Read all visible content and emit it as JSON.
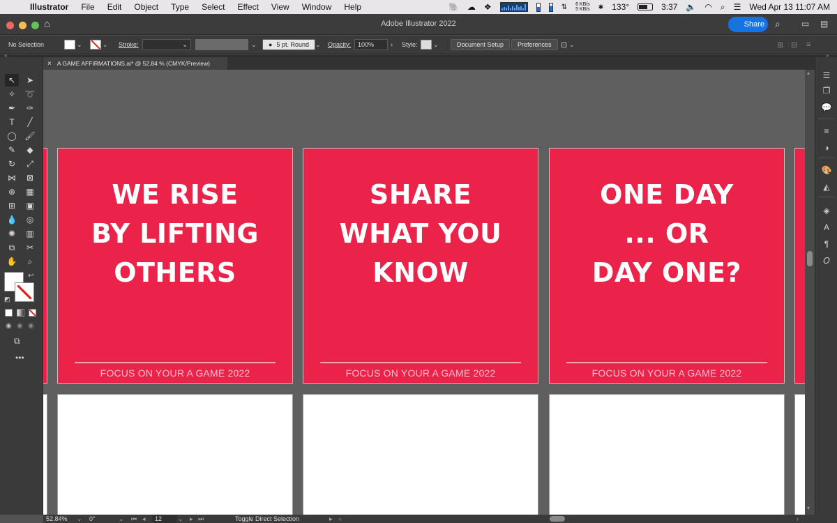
{
  "menubar": {
    "app": "Illustrator",
    "items": [
      "File",
      "Edit",
      "Object",
      "Type",
      "Select",
      "Effect",
      "View",
      "Window",
      "Help"
    ],
    "net_up": "6 KB/s",
    "net_down": "5 KB/s",
    "temperature": "133°",
    "battery_time": "3:37",
    "datetime": "Wed Apr 13  11:07 AM"
  },
  "titlebar": {
    "title": "Adobe Illustrator 2022",
    "share_label": "Share"
  },
  "controlbar": {
    "selection": "No Selection",
    "stroke_label": "Stroke:",
    "brush": "5 pt. Round",
    "opacity_label": "Opacity:",
    "opacity_value": "100%",
    "style_label": "Style:",
    "document_setup": "Document Setup",
    "preferences": "Preferences"
  },
  "document_tab": {
    "title": "A GAME AFFIRMATIONS.ai* @ 52.84 % (CMYK/Preview)"
  },
  "artboards": [
    {
      "headline": "WE RISE\nBY LIFTING\nOTHERS",
      "footer": "FOCUS ON YOUR A GAME 2022"
    },
    {
      "headline": "SHARE\nWHAT YOU\nKNOW",
      "footer": "FOCUS ON YOUR A GAME 2022"
    },
    {
      "headline": "ONE DAY\n... OR\nDAY ONE?",
      "footer": "FOCUS ON YOUR A GAME 2022"
    }
  ],
  "statusbar": {
    "zoom": "52.84%",
    "rotation": "0°",
    "artboard_number": "12",
    "tool_hint": "Toggle Direct Selection"
  },
  "colors": {
    "artboard_red": "#eb234a",
    "share_blue": "#1473e6"
  }
}
